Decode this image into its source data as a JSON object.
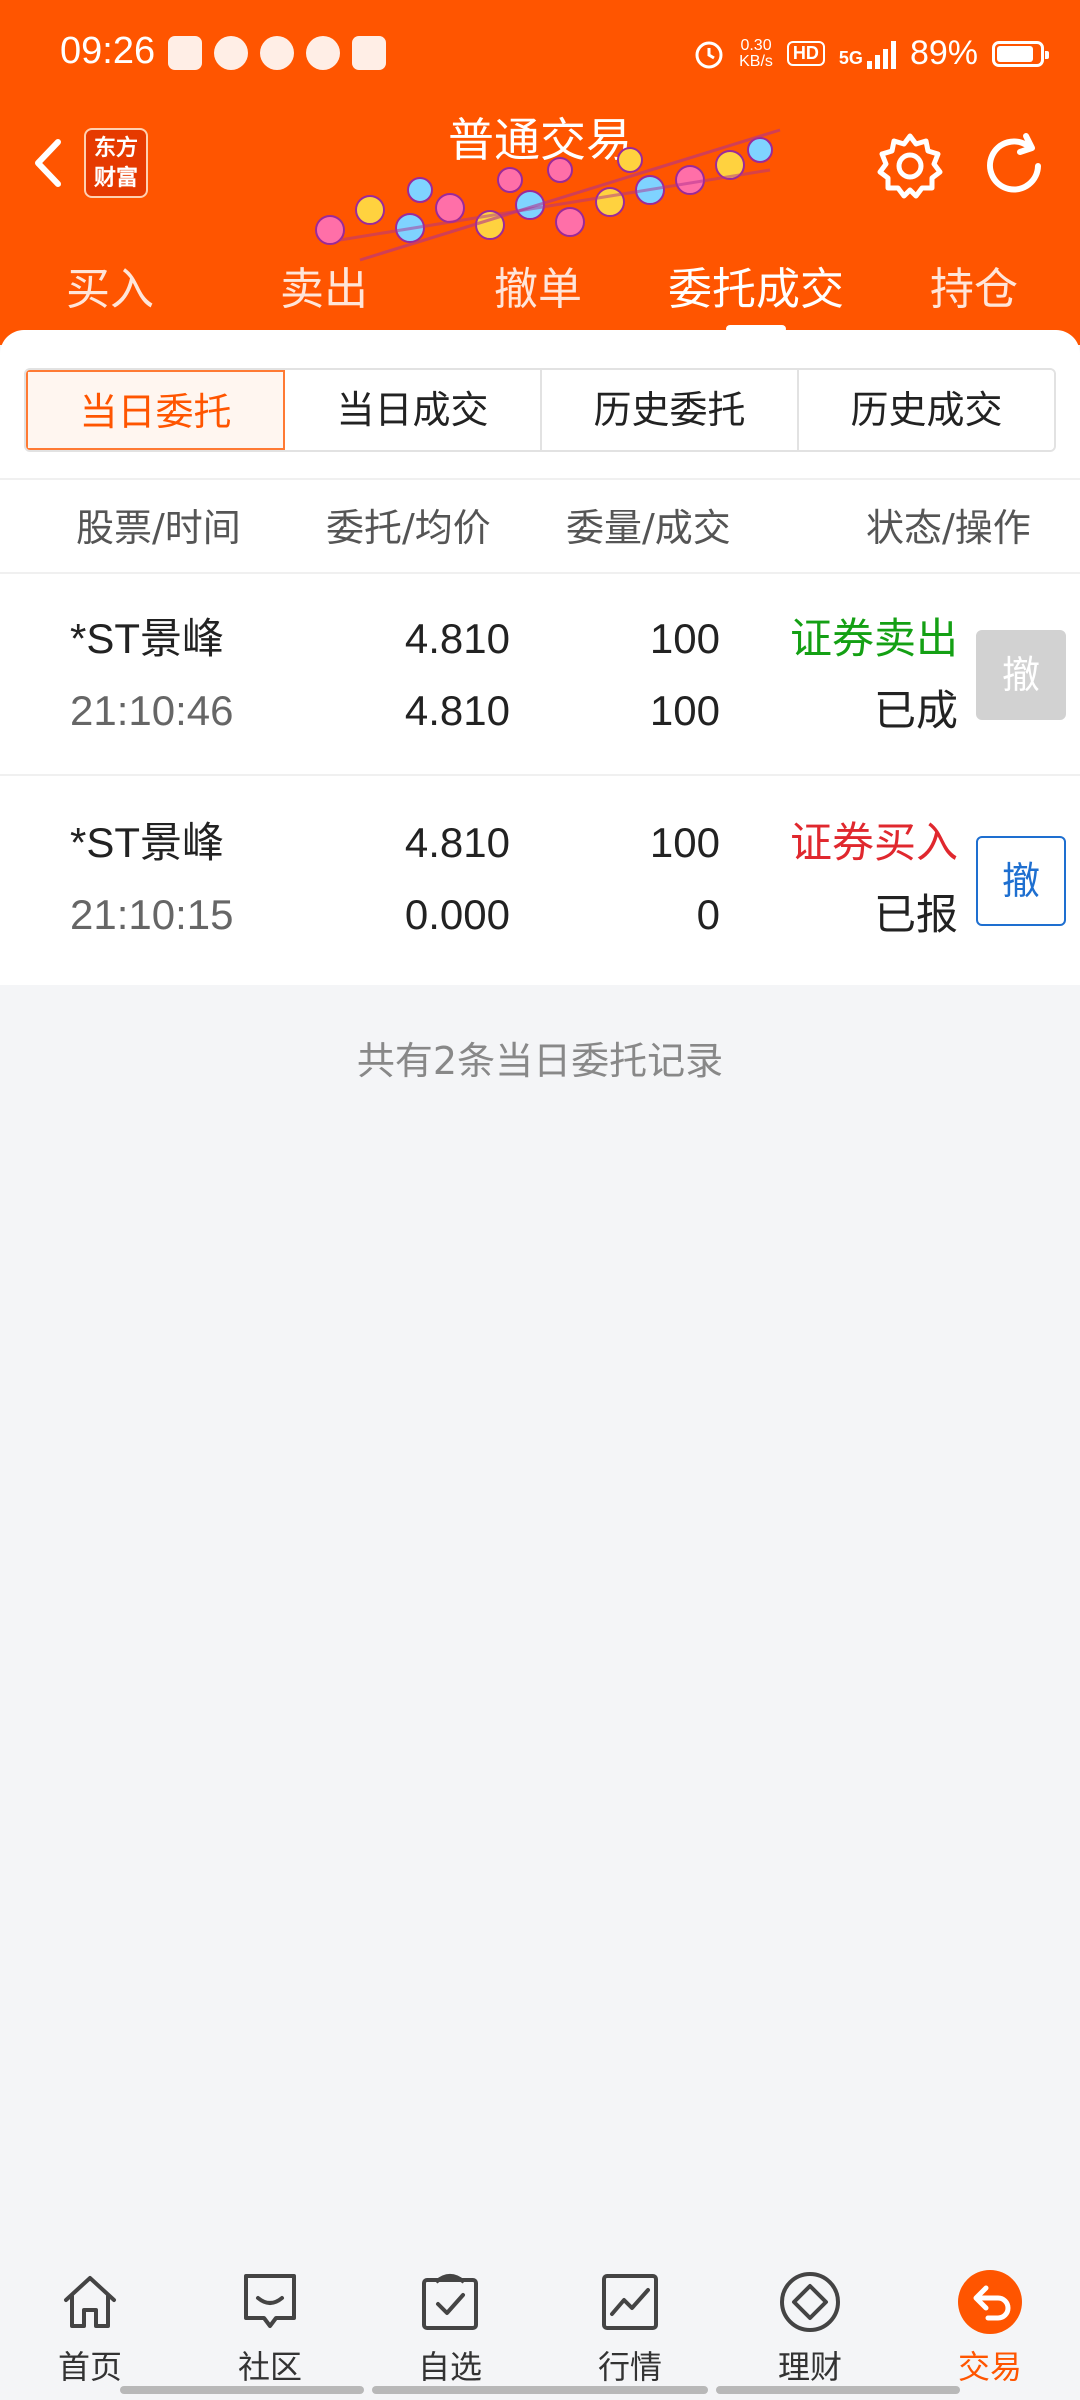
{
  "status_bar": {
    "time": "09:26",
    "net_speed_value": "0.30",
    "net_speed_unit": "KB/s",
    "hd": "HD",
    "network": "5G",
    "battery": "89%"
  },
  "header": {
    "back_icon": "chevron-left-icon",
    "logo_text_1": "东方",
    "logo_text_2": "财富",
    "title": "普通交易",
    "subtitle": "",
    "settings_icon": "gear-icon",
    "refresh_icon": "refresh-icon"
  },
  "tabs": [
    {
      "label": "买入"
    },
    {
      "label": "卖出"
    },
    {
      "label": "撤单"
    },
    {
      "label": "委托成交",
      "active": true
    },
    {
      "label": "持仓"
    }
  ],
  "segments": [
    {
      "label": "当日委托",
      "active": true
    },
    {
      "label": "当日成交"
    },
    {
      "label": "历史委托"
    },
    {
      "label": "历史成交"
    }
  ],
  "columns": {
    "stock_time": "股票/时间",
    "price_avg": "委托/均价",
    "qty_filled": "委量/成交",
    "status_action": "状态/操作"
  },
  "orders": [
    {
      "name": "*ST景峰",
      "time": "21:10:46",
      "price": "4.810",
      "avg_price": "4.810",
      "quantity": "100",
      "filled": "100",
      "side": "证券卖出",
      "status": "已成",
      "cancel_label": "撤",
      "cancel_enabled": false
    },
    {
      "name": "*ST景峰",
      "time": "21:10:15",
      "price": "4.810",
      "avg_price": "0.000",
      "quantity": "100",
      "filled": "0",
      "side": "证券买入",
      "status": "已报",
      "cancel_label": "撤",
      "cancel_enabled": true
    }
  ],
  "record_count": "共有2条当日委托记录",
  "bottom_nav": [
    {
      "label": "首页",
      "icon": "home-icon"
    },
    {
      "label": "社区",
      "icon": "community-icon"
    },
    {
      "label": "自选",
      "icon": "watchlist-icon"
    },
    {
      "label": "行情",
      "icon": "market-chart-icon"
    },
    {
      "label": "理财",
      "icon": "wealth-diamond-icon"
    },
    {
      "label": "交易",
      "icon": "trade-icon",
      "active": true
    }
  ],
  "colors": {
    "brand": "#ff5500",
    "sell": "#14a014",
    "buy": "#e0282e",
    "cancel_blue": "#1e6fd0"
  }
}
